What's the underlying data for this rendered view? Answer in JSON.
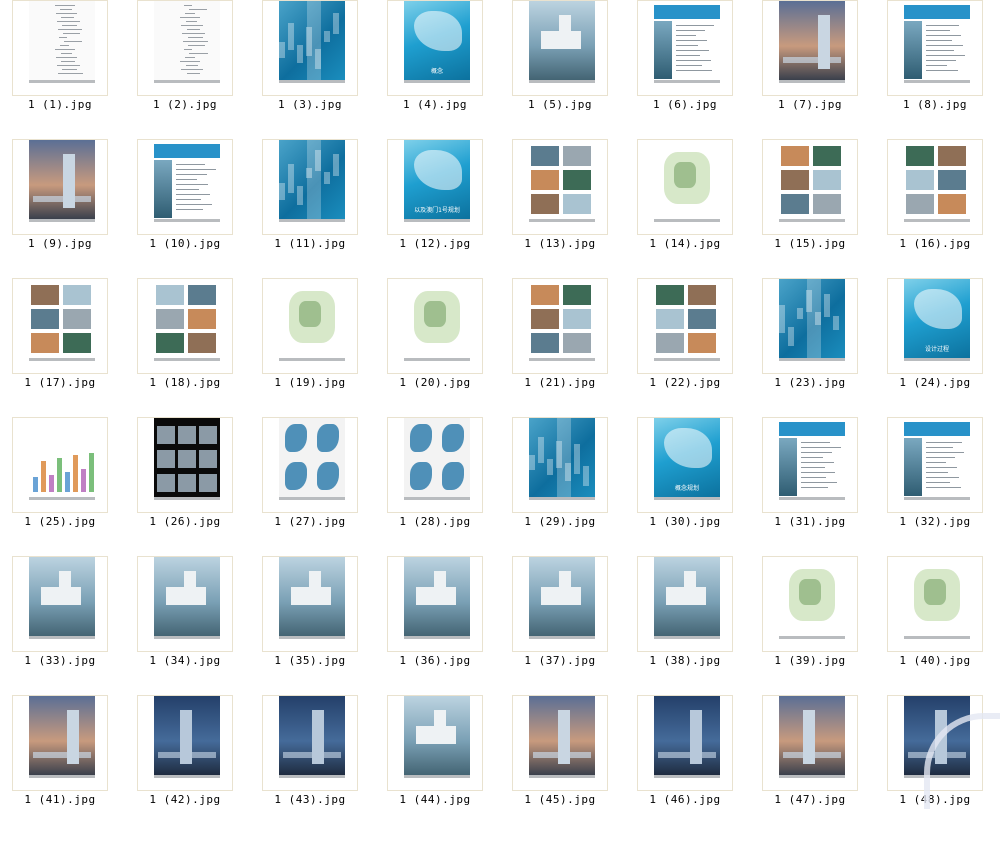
{
  "thumbnails": [
    {
      "filename": "1 (1).jpg",
      "type": "text"
    },
    {
      "filename": "1 (2).jpg",
      "type": "text"
    },
    {
      "filename": "1 (3).jpg",
      "type": "blueaerial"
    },
    {
      "filename": "1 (4).jpg",
      "type": "bluesea",
      "caption": "概念"
    },
    {
      "filename": "1 (5).jpg",
      "type": "render"
    },
    {
      "filename": "1 (6).jpg",
      "type": "hdr"
    },
    {
      "filename": "1 (7).jpg",
      "type": "dusk"
    },
    {
      "filename": "1 (8).jpg",
      "type": "hdr"
    },
    {
      "filename": "1 (9).jpg",
      "type": "dusk"
    },
    {
      "filename": "1 (10).jpg",
      "type": "hdr"
    },
    {
      "filename": "1 (11).jpg",
      "type": "blueaerial"
    },
    {
      "filename": "1 (12).jpg",
      "type": "bluesea",
      "caption": "以及澳门1号规划"
    },
    {
      "filename": "1 (13).jpg",
      "type": "collage"
    },
    {
      "filename": "1 (14).jpg",
      "type": "plan"
    },
    {
      "filename": "1 (15).jpg",
      "type": "collage"
    },
    {
      "filename": "1 (16).jpg",
      "type": "collage"
    },
    {
      "filename": "1 (17).jpg",
      "type": "collage"
    },
    {
      "filename": "1 (18).jpg",
      "type": "collage"
    },
    {
      "filename": "1 (19).jpg",
      "type": "plan"
    },
    {
      "filename": "1 (20).jpg",
      "type": "plan"
    },
    {
      "filename": "1 (21).jpg",
      "type": "collage"
    },
    {
      "filename": "1 (22).jpg",
      "type": "collage"
    },
    {
      "filename": "1 (23).jpg",
      "type": "blueaerial"
    },
    {
      "filename": "1 (24).jpg",
      "type": "bluesea",
      "caption": "设计过程"
    },
    {
      "filename": "1 (25).jpg",
      "type": "chart"
    },
    {
      "filename": "1 (26).jpg",
      "type": "dark"
    },
    {
      "filename": "1 (27).jpg",
      "type": "clay"
    },
    {
      "filename": "1 (28).jpg",
      "type": "clay"
    },
    {
      "filename": "1 (29).jpg",
      "type": "blueaerial"
    },
    {
      "filename": "1 (30).jpg",
      "type": "bluesea",
      "caption": "概念规划"
    },
    {
      "filename": "1 (31).jpg",
      "type": "hdr"
    },
    {
      "filename": "1 (32).jpg",
      "type": "hdr"
    },
    {
      "filename": "1 (33).jpg",
      "type": "render"
    },
    {
      "filename": "1 (34).jpg",
      "type": "render"
    },
    {
      "filename": "1 (35).jpg",
      "type": "render"
    },
    {
      "filename": "1 (36).jpg",
      "type": "render"
    },
    {
      "filename": "1 (37).jpg",
      "type": "render"
    },
    {
      "filename": "1 (38).jpg",
      "type": "render"
    },
    {
      "filename": "1 (39).jpg",
      "type": "plan"
    },
    {
      "filename": "1 (40).jpg",
      "type": "plan"
    },
    {
      "filename": "1 (41).jpg",
      "type": "dusk"
    },
    {
      "filename": "1 (42).jpg",
      "type": "night"
    },
    {
      "filename": "1 (43).jpg",
      "type": "night"
    },
    {
      "filename": "1 (44).jpg",
      "type": "render"
    },
    {
      "filename": "1 (45).jpg",
      "type": "dusk"
    },
    {
      "filename": "1 (46).jpg",
      "type": "night"
    },
    {
      "filename": "1 (47).jpg",
      "type": "dusk"
    },
    {
      "filename": "1 (48).jpg",
      "type": "night"
    }
  ]
}
